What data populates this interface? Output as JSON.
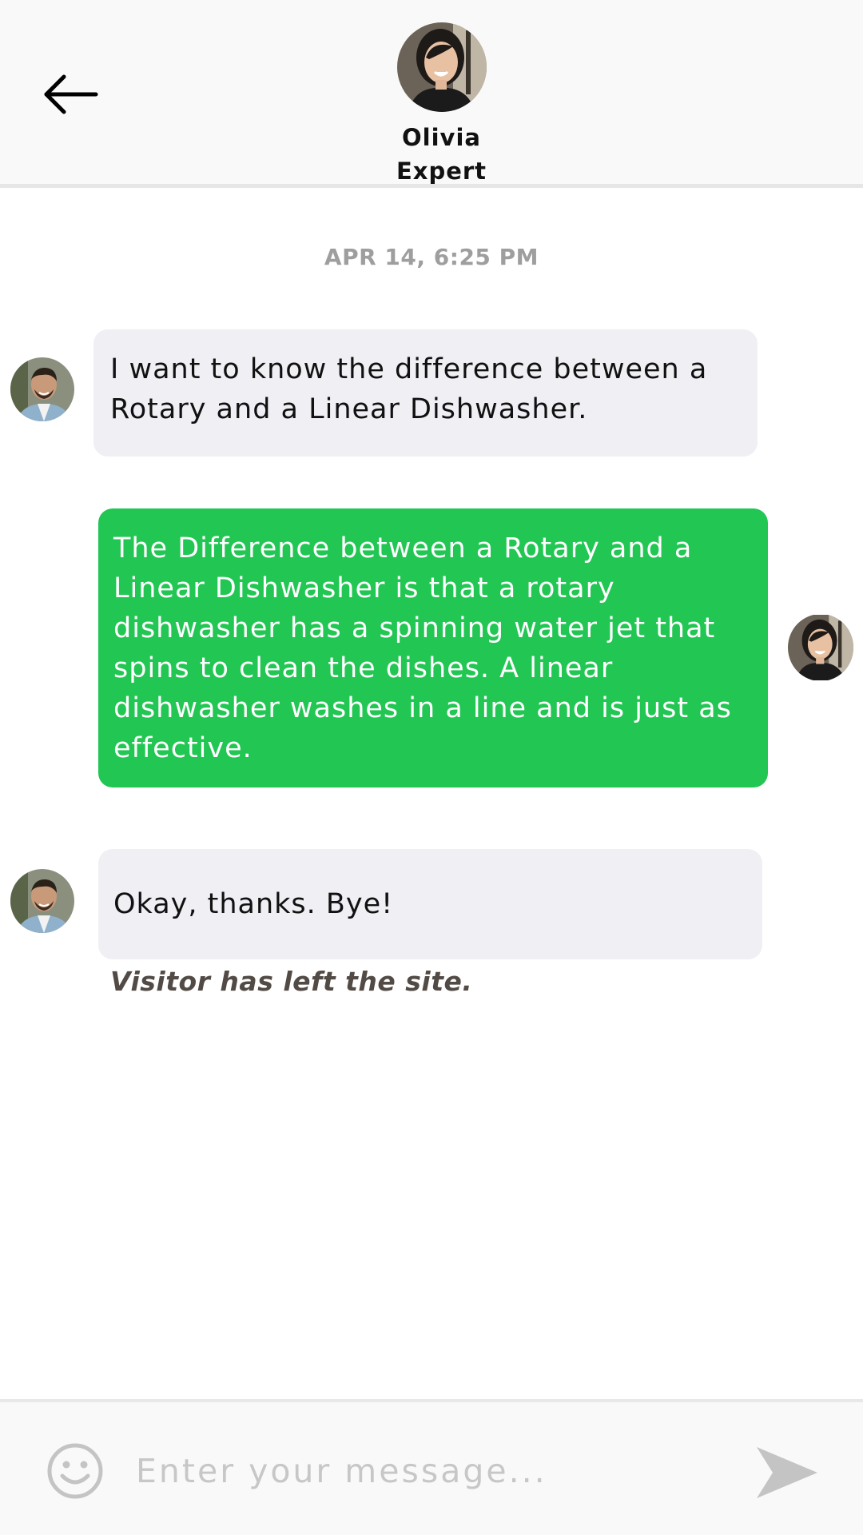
{
  "header": {
    "name": "Olivia",
    "role": "Expert",
    "back_icon": "arrow-left-icon"
  },
  "conversation": {
    "timestamp": "APR 14, 6:25 PM",
    "messages": [
      {
        "sender": "visitor",
        "text": "I want to know the difference between a Rotary and a Linear Dishwasher."
      },
      {
        "sender": "agent",
        "text": "The Difference between a Rotary and a Linear Dishwasher is that a rotary dishwasher has a spinning water jet that spins to clean the dishes. A linear dishwasher washes in a line and is just as effective."
      },
      {
        "sender": "visitor",
        "text": "Okay, thanks. Bye!"
      }
    ],
    "system_note": "Visitor has left the site."
  },
  "composer": {
    "placeholder": "Enter your message...",
    "emoji_icon": "smiley-icon",
    "send_icon": "send-icon"
  },
  "colors": {
    "agent_bubble": "#22c653",
    "visitor_bubble": "#efeff4",
    "header_bg": "#f9f9f9",
    "timestamp": "#9e9e9e",
    "system_note": "#524a45"
  }
}
